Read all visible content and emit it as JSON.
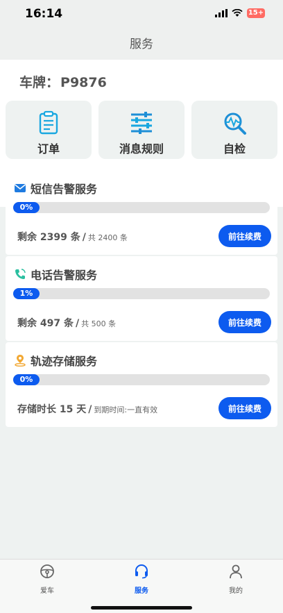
{
  "status_bar": {
    "time": "16:14",
    "battery": "15+"
  },
  "header": {
    "title": "服务"
  },
  "plate": {
    "label": "车牌：",
    "value": "P9876"
  },
  "tiles": [
    {
      "label": "订单",
      "icon": "clipboard-icon"
    },
    {
      "label": "消息规则",
      "icon": "sliders-icon"
    },
    {
      "label": "自检",
      "icon": "diagnostic-search-icon"
    }
  ],
  "services": [
    {
      "title": "短信告警服务",
      "icon": "envelope-icon",
      "progress_label": "0%",
      "progress": 0,
      "remaining": "剩余 2399 条",
      "total": "共 2400 条",
      "button": "前往续费"
    },
    {
      "title": "电话告警服务",
      "icon": "phone-icon",
      "progress_label": "1%",
      "progress": 1,
      "remaining": "剩余 497 条",
      "total": "共 500 条",
      "button": "前往续费"
    },
    {
      "title": "轨迹存储服务",
      "icon": "location-pin-icon",
      "progress_label": "0%",
      "progress": 0,
      "remaining": "存储时长 15 天",
      "total": "到期时间:一直有效",
      "button": "前往续费"
    }
  ],
  "tabbar": [
    {
      "label": "爱车",
      "icon": "steering-wheel-icon",
      "active": false
    },
    {
      "label": "服务",
      "icon": "headset-icon",
      "active": true
    },
    {
      "label": "我的",
      "icon": "person-icon",
      "active": false
    }
  ],
  "colors": {
    "accent": "#0d5bef",
    "background": "#eef2f1"
  }
}
